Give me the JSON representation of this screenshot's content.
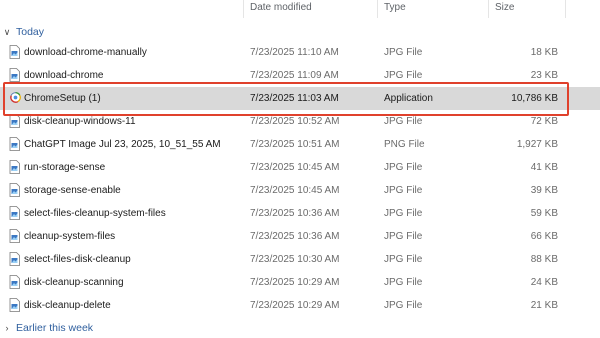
{
  "columns": {
    "date": "Date modified",
    "type": "Type",
    "size": "Size"
  },
  "groups": {
    "today": "Today",
    "earlier": "Earlier this week"
  },
  "files": [
    {
      "name": "download-chrome-manually",
      "date": "7/23/2025 11:10 AM",
      "type": "JPG File",
      "size": "18 KB",
      "icon": "jpg-file-icon"
    },
    {
      "name": "download-chrome",
      "date": "7/23/2025 11:09 AM",
      "type": "JPG File",
      "size": "23 KB",
      "icon": "jpg-file-icon"
    },
    {
      "name": "ChromeSetup (1)",
      "date": "7/23/2025 11:03 AM",
      "type": "Application",
      "size": "10,786 KB",
      "icon": "installer-app-icon",
      "selected": true
    },
    {
      "name": "disk-cleanup-windows-11",
      "date": "7/23/2025 10:52 AM",
      "type": "JPG File",
      "size": "72 KB",
      "icon": "jpg-file-icon"
    },
    {
      "name": "ChatGPT Image Jul 23, 2025, 10_51_55 AM",
      "date": "7/23/2025 10:51 AM",
      "type": "PNG File",
      "size": "1,927 KB",
      "icon": "png-file-icon"
    },
    {
      "name": "run-storage-sense",
      "date": "7/23/2025 10:45 AM",
      "type": "JPG File",
      "size": "41 KB",
      "icon": "jpg-file-icon"
    },
    {
      "name": "storage-sense-enable",
      "date": "7/23/2025 10:45 AM",
      "type": "JPG File",
      "size": "39 KB",
      "icon": "jpg-file-icon"
    },
    {
      "name": "select-files-cleanup-system-files",
      "date": "7/23/2025 10:36 AM",
      "type": "JPG File",
      "size": "59 KB",
      "icon": "jpg-file-icon"
    },
    {
      "name": "cleanup-system-files",
      "date": "7/23/2025 10:36 AM",
      "type": "JPG File",
      "size": "66 KB",
      "icon": "jpg-file-icon"
    },
    {
      "name": "select-files-disk-cleanup",
      "date": "7/23/2025 10:30 AM",
      "type": "JPG File",
      "size": "88 KB",
      "icon": "jpg-file-icon"
    },
    {
      "name": "disk-cleanup-scanning",
      "date": "7/23/2025 10:29 AM",
      "type": "JPG File",
      "size": "24 KB",
      "icon": "jpg-file-icon"
    },
    {
      "name": "disk-cleanup-delete",
      "date": "7/23/2025 10:29 AM",
      "type": "JPG File",
      "size": "21 KB",
      "icon": "jpg-file-icon"
    }
  ],
  "colors": {
    "selection_bg": "#d9d9d9",
    "highlight_border": "#e0412c",
    "group_text": "#2f5f9e"
  }
}
